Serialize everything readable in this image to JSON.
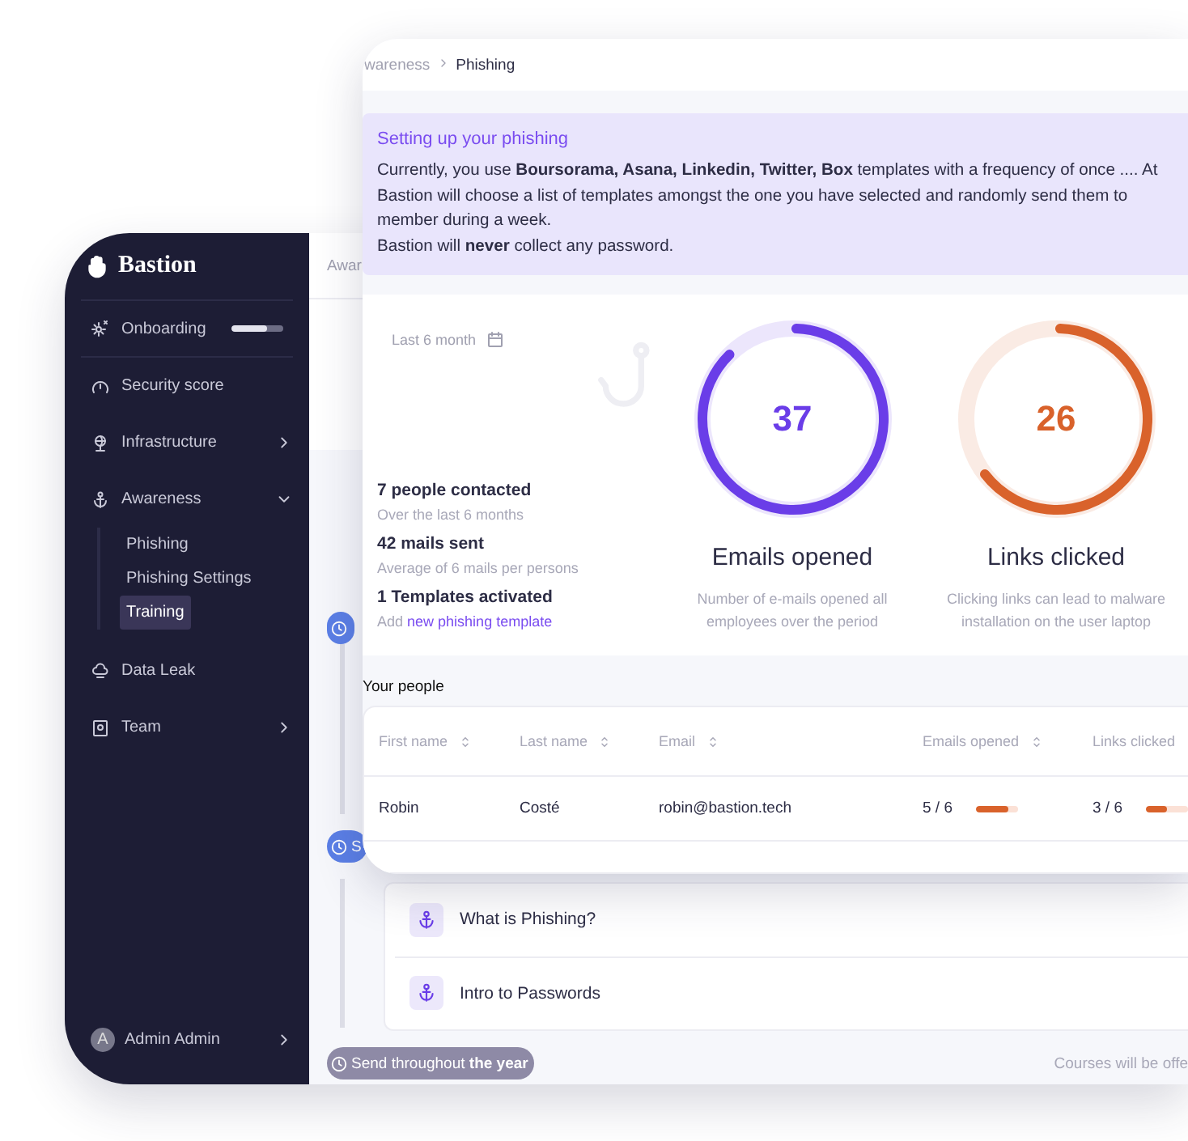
{
  "sidebar": {
    "logo": "Bastion",
    "items": [
      {
        "kind": "progress",
        "label": "Onboarding",
        "level": 0.68
      },
      {
        "kind": "plain",
        "label": "Security score"
      },
      {
        "kind": "submenu",
        "label": "Infrastructure",
        "expanded": false
      },
      {
        "kind": "submenu",
        "label": "Awareness",
        "expanded": true,
        "children": [
          {
            "label": "Phishing",
            "selected": false
          },
          {
            "label": "Phishing Settings",
            "selected": false
          },
          {
            "label": "Training",
            "selected": true
          }
        ]
      },
      {
        "kind": "plain",
        "label": "Data Leak"
      },
      {
        "kind": "submenu",
        "label": "Team",
        "expanded": false
      }
    ],
    "user": {
      "initial": "A",
      "name": "Admin Admin"
    }
  },
  "back_page": {
    "breadcrumb": "Awar",
    "schedule": [
      {
        "active": true
      },
      {
        "active": true,
        "label": "S"
      },
      {
        "active": false,
        "label": "Send throughout **the year**"
      }
    ],
    "courses": [
      {
        "title": "What is Phishing?"
      },
      {
        "title": "Intro to Passwords"
      }
    ],
    "courses_note": "Courses will be offe"
  },
  "front_page": {
    "breadcrumb": [
      "wareness",
      "Phishing"
    ],
    "notice": {
      "title": "Setting up your phishing",
      "lines": [
        "Currently, you use **Boursorama, Asana, Linkedin, Twitter, Box** templates with a frequency of once .... At",
        "Bastion will choose a list of templates amongst the one you have selected and randomly send them to",
        "member during a week.",
        "Bastion will **never** collect any password."
      ]
    },
    "period": "Last 6 month",
    "stats": [
      {
        "value": "7 people contacted",
        "detail": "Over the last 6 months"
      },
      {
        "value": "42 mails sent",
        "detail": "Average of 6 mails per persons"
      },
      {
        "value": "1 Templates activated",
        "detail": "Add",
        "link": "new phishing template"
      }
    ],
    "meters": [
      {
        "value": "37",
        "label": "Emails opened",
        "description": "Number of e-mails opened all employees over the period",
        "level": 0.87,
        "color": "#6a3de8"
      },
      {
        "value": "26",
        "label": "Links clicked",
        "description": "Clicking links can lead to malware installation on the user laptop",
        "level": 0.64,
        "color": "#d9622b"
      }
    ],
    "people": {
      "title": "Your people",
      "columns": [
        {
          "label": "First name",
          "sortable": true
        },
        {
          "label": "Last name",
          "sortable": true
        },
        {
          "label": "Email",
          "sortable": true
        },
        {
          "label": "Emails opened",
          "sortable": true
        },
        {
          "label": "Links clicked"
        }
      ],
      "rows": [
        {
          "first_name": "Robin",
          "last_name": "Costé",
          "email": "robin@bastion.tech",
          "emails_opened": {
            "text": "5 / 6",
            "level": 0.8
          },
          "links_clicked": {
            "text": "3 / 6",
            "level": 0.5
          }
        }
      ]
    }
  }
}
